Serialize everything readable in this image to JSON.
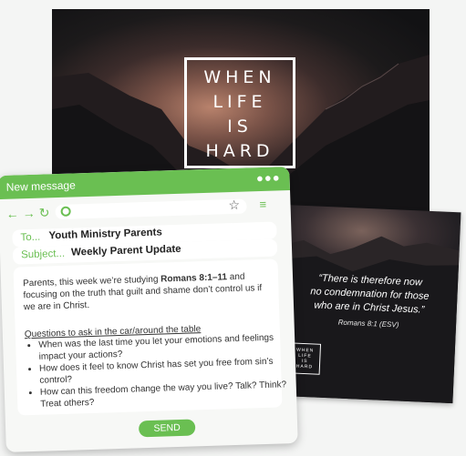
{
  "poster": {
    "title_lines": [
      "WHEN",
      "LIFE",
      "IS",
      "HARD"
    ]
  },
  "verse_card": {
    "quote_lines": [
      "“There is therefore now",
      "no condemnation for those",
      "who are in Christ Jesus.”"
    ],
    "reference": "Romans 8:1 (ESV)",
    "logo_lines": [
      "WHEN",
      "LIFE",
      "IS",
      "HARD"
    ]
  },
  "email": {
    "window_title": "New message",
    "menu_dots": "●●●",
    "toolbar": {
      "back_icon": "←",
      "forward_icon": "→",
      "reload_icon": "↻",
      "star_icon": "☆",
      "menu_icon": "≡"
    },
    "to_label": "To...",
    "to_value": "Youth Ministry Parents",
    "subject_label": "Subject...",
    "subject_value": "Weekly Parent Update",
    "intro_before": "Parents, this week we’re studying ",
    "intro_bold": "Romans 8:1–11",
    "intro_after": " and focusing on the truth that guilt and shame don’t control us if we are in Christ.",
    "questions_heading": "Questions to ask in the car/around the table",
    "questions": [
      "When was the last time you let your emotions and feelings impact your actions?",
      "How does it feel to know Christ has set you free from sin’s control?",
      "How can this freedom change the way you live? Talk? Think? Treat others?"
    ],
    "send_label": "SEND"
  },
  "colors": {
    "accent": "#6abf52",
    "window_bg": "#f7f8f6"
  }
}
